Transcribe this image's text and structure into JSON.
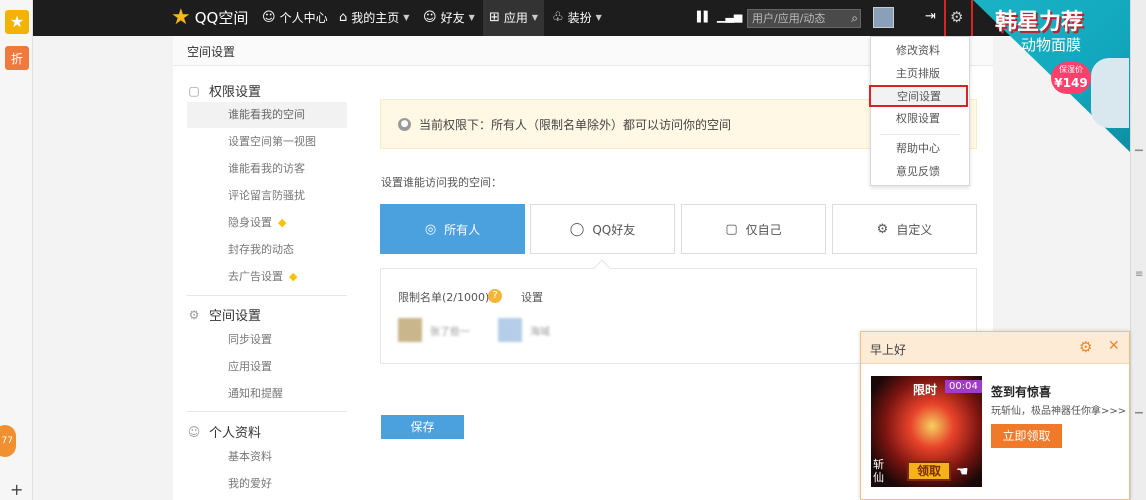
{
  "leftbar": {
    "badge": "77",
    "plus": "+",
    "bag_label": "折"
  },
  "topbar": {
    "logo": "QQ空间",
    "nav": [
      {
        "label": "个人中心",
        "icon": "person-icon"
      },
      {
        "label": "我的主页",
        "icon": "home-icon"
      },
      {
        "label": "好友",
        "icon": "friends-icon"
      },
      {
        "label": "应用",
        "icon": "apps-grid-icon"
      },
      {
        "label": "装扮",
        "icon": "shirt-icon"
      }
    ],
    "search_placeholder": "用户/应用/动态"
  },
  "ad": {
    "title": "韩星力荐",
    "subtitle": "动物面膜",
    "tag_top": "保湿价",
    "tag_price": "¥149"
  },
  "page": {
    "header": "空间设置"
  },
  "sidebar": {
    "sections": [
      {
        "title": "权限设置",
        "items": [
          {
            "label": "谁能看我的空间"
          },
          {
            "label": "设置空间第一视图"
          },
          {
            "label": "谁能看我的访客"
          },
          {
            "label": "评论留言防骚扰"
          },
          {
            "label": "隐身设置"
          },
          {
            "label": "封存我的动态"
          },
          {
            "label": "去广告设置"
          }
        ]
      },
      {
        "title": "空间设置",
        "items": [
          {
            "label": "同步设置"
          },
          {
            "label": "应用设置"
          },
          {
            "label": "通知和提醒"
          }
        ]
      },
      {
        "title": "个人资料",
        "items": [
          {
            "label": "基本资料"
          },
          {
            "label": "我的爱好"
          }
        ]
      }
    ]
  },
  "main": {
    "notice": "当前权限下：所有人（限制名单除外）都可以访问你的空间",
    "field_label": "设置谁能访问我的空间：",
    "options": [
      {
        "label": "所有人",
        "active": true
      },
      {
        "label": "QQ好友",
        "active": false
      },
      {
        "label": "仅自己",
        "active": false
      },
      {
        "label": "自定义",
        "active": false
      }
    ],
    "restrict": {
      "title": "限制名单(2/1000)",
      "link": "设置",
      "friends": [
        {
          "name": "张了些一"
        },
        {
          "name": "海域"
        }
      ]
    },
    "save": "保存"
  },
  "menu": {
    "items": [
      "修改资料",
      "主页排版",
      "空间设置",
      "权限设置",
      "帮助中心",
      "意见反馈"
    ]
  },
  "popup": {
    "title": "早上好",
    "img_tag": "限时",
    "img_timer": "00:04",
    "img_btn": "领取",
    "img_side": "斩仙",
    "heading": "签到有惊喜",
    "desc": "玩斩仙，极品神器任你拿>>>",
    "button": "立即领取"
  }
}
